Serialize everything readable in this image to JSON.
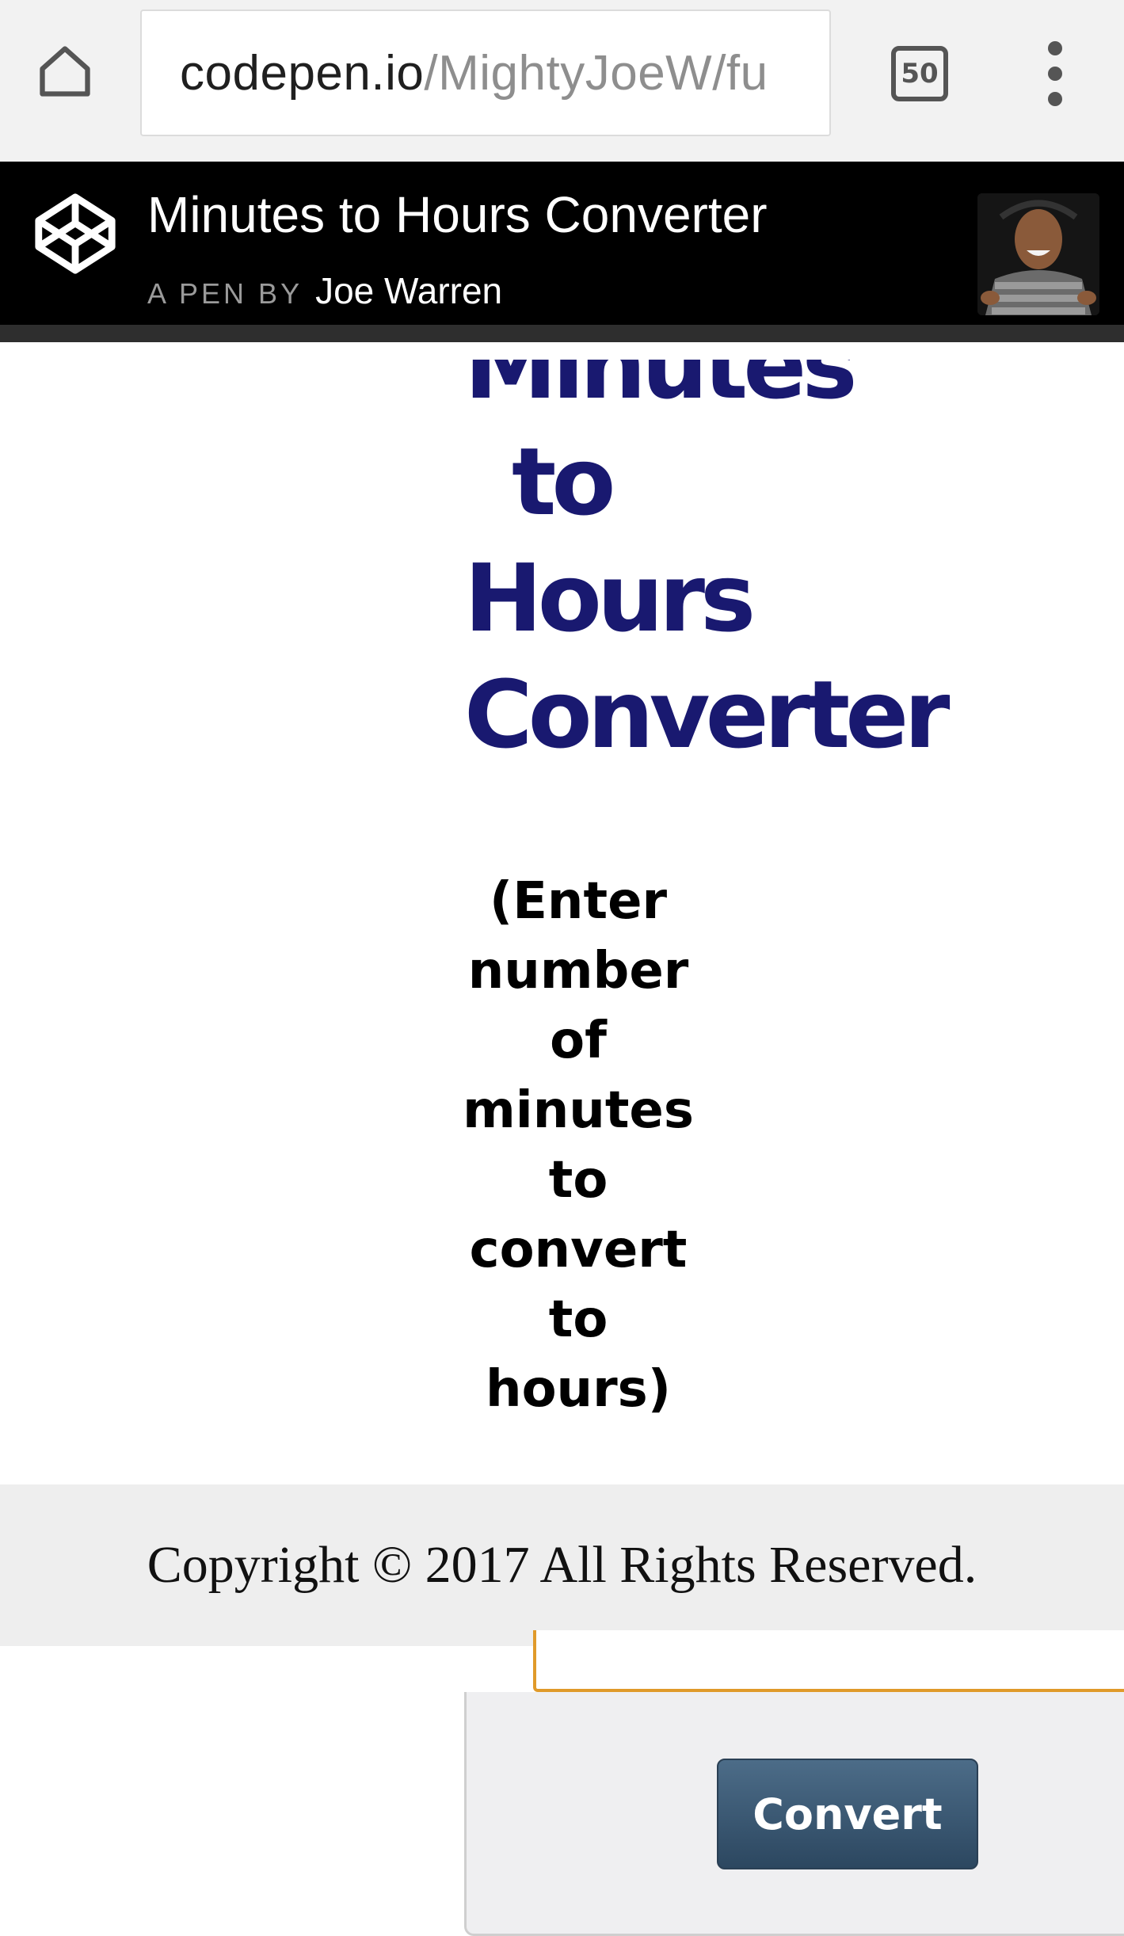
{
  "browser": {
    "url_host": "codepen.io",
    "url_path": "/MightyJoeW/fu",
    "tab_count": "50"
  },
  "codepen": {
    "title": "Minutes to Hours Converter",
    "pen_by": "A PEN BY",
    "author": "Joe Warren"
  },
  "page": {
    "title_line1": "Minutes",
    "title_line2": "to",
    "title_line3": "Hours",
    "title_line4": "Converter",
    "instructions_lines": [
      "(Enter",
      "number",
      "of",
      "minutes",
      "to",
      "convert",
      "to",
      "hours)"
    ],
    "title_color": "#191970",
    "minutes_value": ""
  },
  "footer": {
    "copyright": "Copyright © 2017 All Rights Reserved."
  },
  "form": {
    "convert_label": "Convert",
    "button_color": "#3a5670",
    "input_border_color": "#e09a2a"
  },
  "icons": {
    "home": "home-icon",
    "tabs": "tab-switcher-icon",
    "menu": "overflow-menu-icon",
    "logo": "codepen-logo-icon"
  }
}
